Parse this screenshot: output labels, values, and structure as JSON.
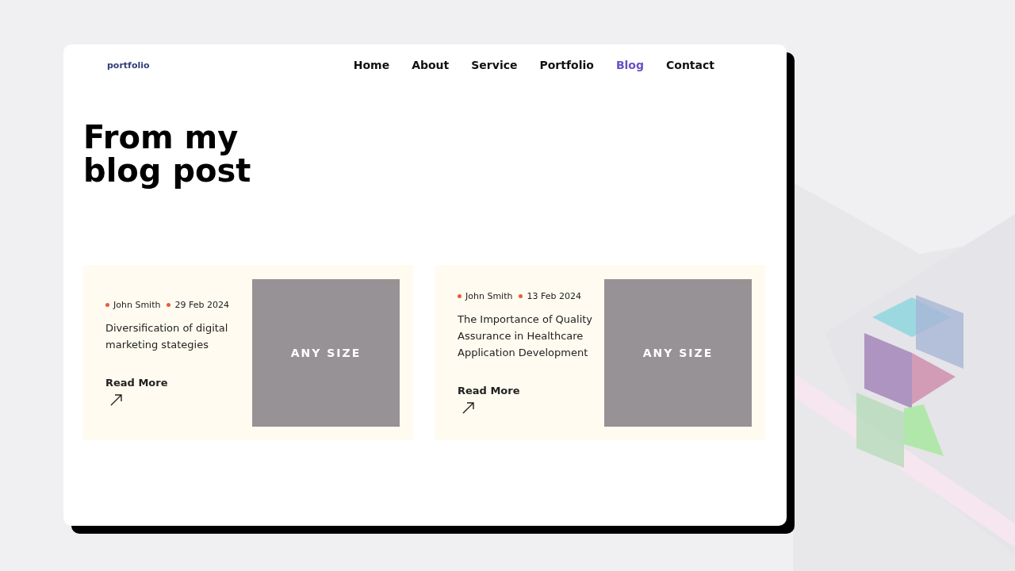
{
  "logo": "portfolio",
  "nav": [
    {
      "label": "Home",
      "selected": false
    },
    {
      "label": "About",
      "selected": false
    },
    {
      "label": "Service",
      "selected": false
    },
    {
      "label": "Portfolio",
      "selected": false
    },
    {
      "label": "Blog",
      "selected": true
    },
    {
      "label": "Contact",
      "selected": false
    }
  ],
  "heading": "From my blog post",
  "posts": [
    {
      "author": "John Smith",
      "date": "29 Feb 2024",
      "title": "Diversification of digital marketing stategies",
      "link": "Read More",
      "image_label": "ANY SIZE"
    },
    {
      "author": "John Smith",
      "date": "13 Feb 2024",
      "title": "The Importance of Quality Assurance in Healthcare Application Development",
      "link": "Read More",
      "image_label": "ANY SIZE"
    }
  ]
}
